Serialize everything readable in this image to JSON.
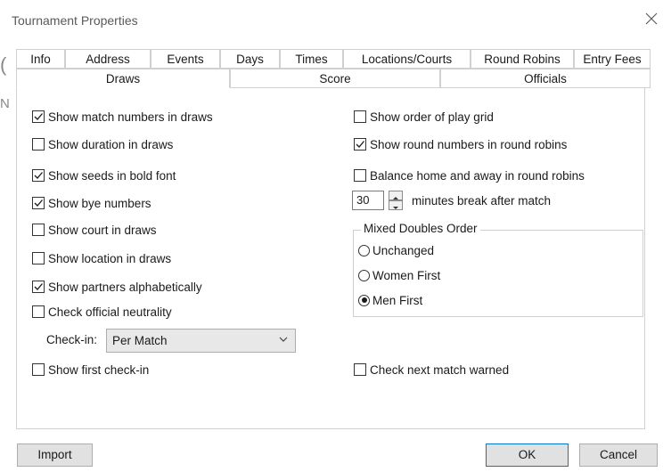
{
  "window": {
    "title": "Tournament Properties"
  },
  "tabs_row1": [
    "Info",
    "Address",
    "Events",
    "Days",
    "Times",
    "Locations/Courts",
    "Round Robins",
    "Entry Fees"
  ],
  "tabs_row2": [
    {
      "label": "Draws",
      "active": true
    },
    {
      "label": "Score",
      "active": false
    },
    {
      "label": "Officials",
      "active": false
    }
  ],
  "left_options": [
    {
      "label": "Show match numbers in draws",
      "checked": true
    },
    {
      "label": "Show duration in draws",
      "checked": false
    },
    {
      "label": "Show seeds in bold font",
      "checked": true
    },
    {
      "label": "Show bye numbers",
      "checked": true
    },
    {
      "label": "Show court in draws",
      "checked": false
    },
    {
      "label": "Show location in draws",
      "checked": false
    },
    {
      "label": "Show partners alphabetically",
      "checked": true
    },
    {
      "label": "Check official neutrality",
      "checked": false
    }
  ],
  "right_options": [
    {
      "label": "Show order of play grid",
      "checked": false
    },
    {
      "label": "Show round numbers in round robins",
      "checked": true
    },
    {
      "label": "Balance home and away in round robins",
      "checked": false
    }
  ],
  "break_spinner": {
    "value": "30",
    "label": "minutes break after match"
  },
  "mixed_doubles": {
    "title": "Mixed Doubles Order",
    "options": [
      {
        "label": "Unchanged",
        "selected": false
      },
      {
        "label": "Women First",
        "selected": false
      },
      {
        "label": "Men First",
        "selected": true
      }
    ]
  },
  "checkin": {
    "label": "Check-in:",
    "value": "Per Match"
  },
  "bottom_options": {
    "first_checkin": {
      "label": "Show first check-in",
      "checked": false
    },
    "next_match_warned": {
      "label": "Check next match warned",
      "checked": false
    }
  },
  "buttons": {
    "import": "Import",
    "ok": "OK",
    "cancel": "Cancel"
  }
}
